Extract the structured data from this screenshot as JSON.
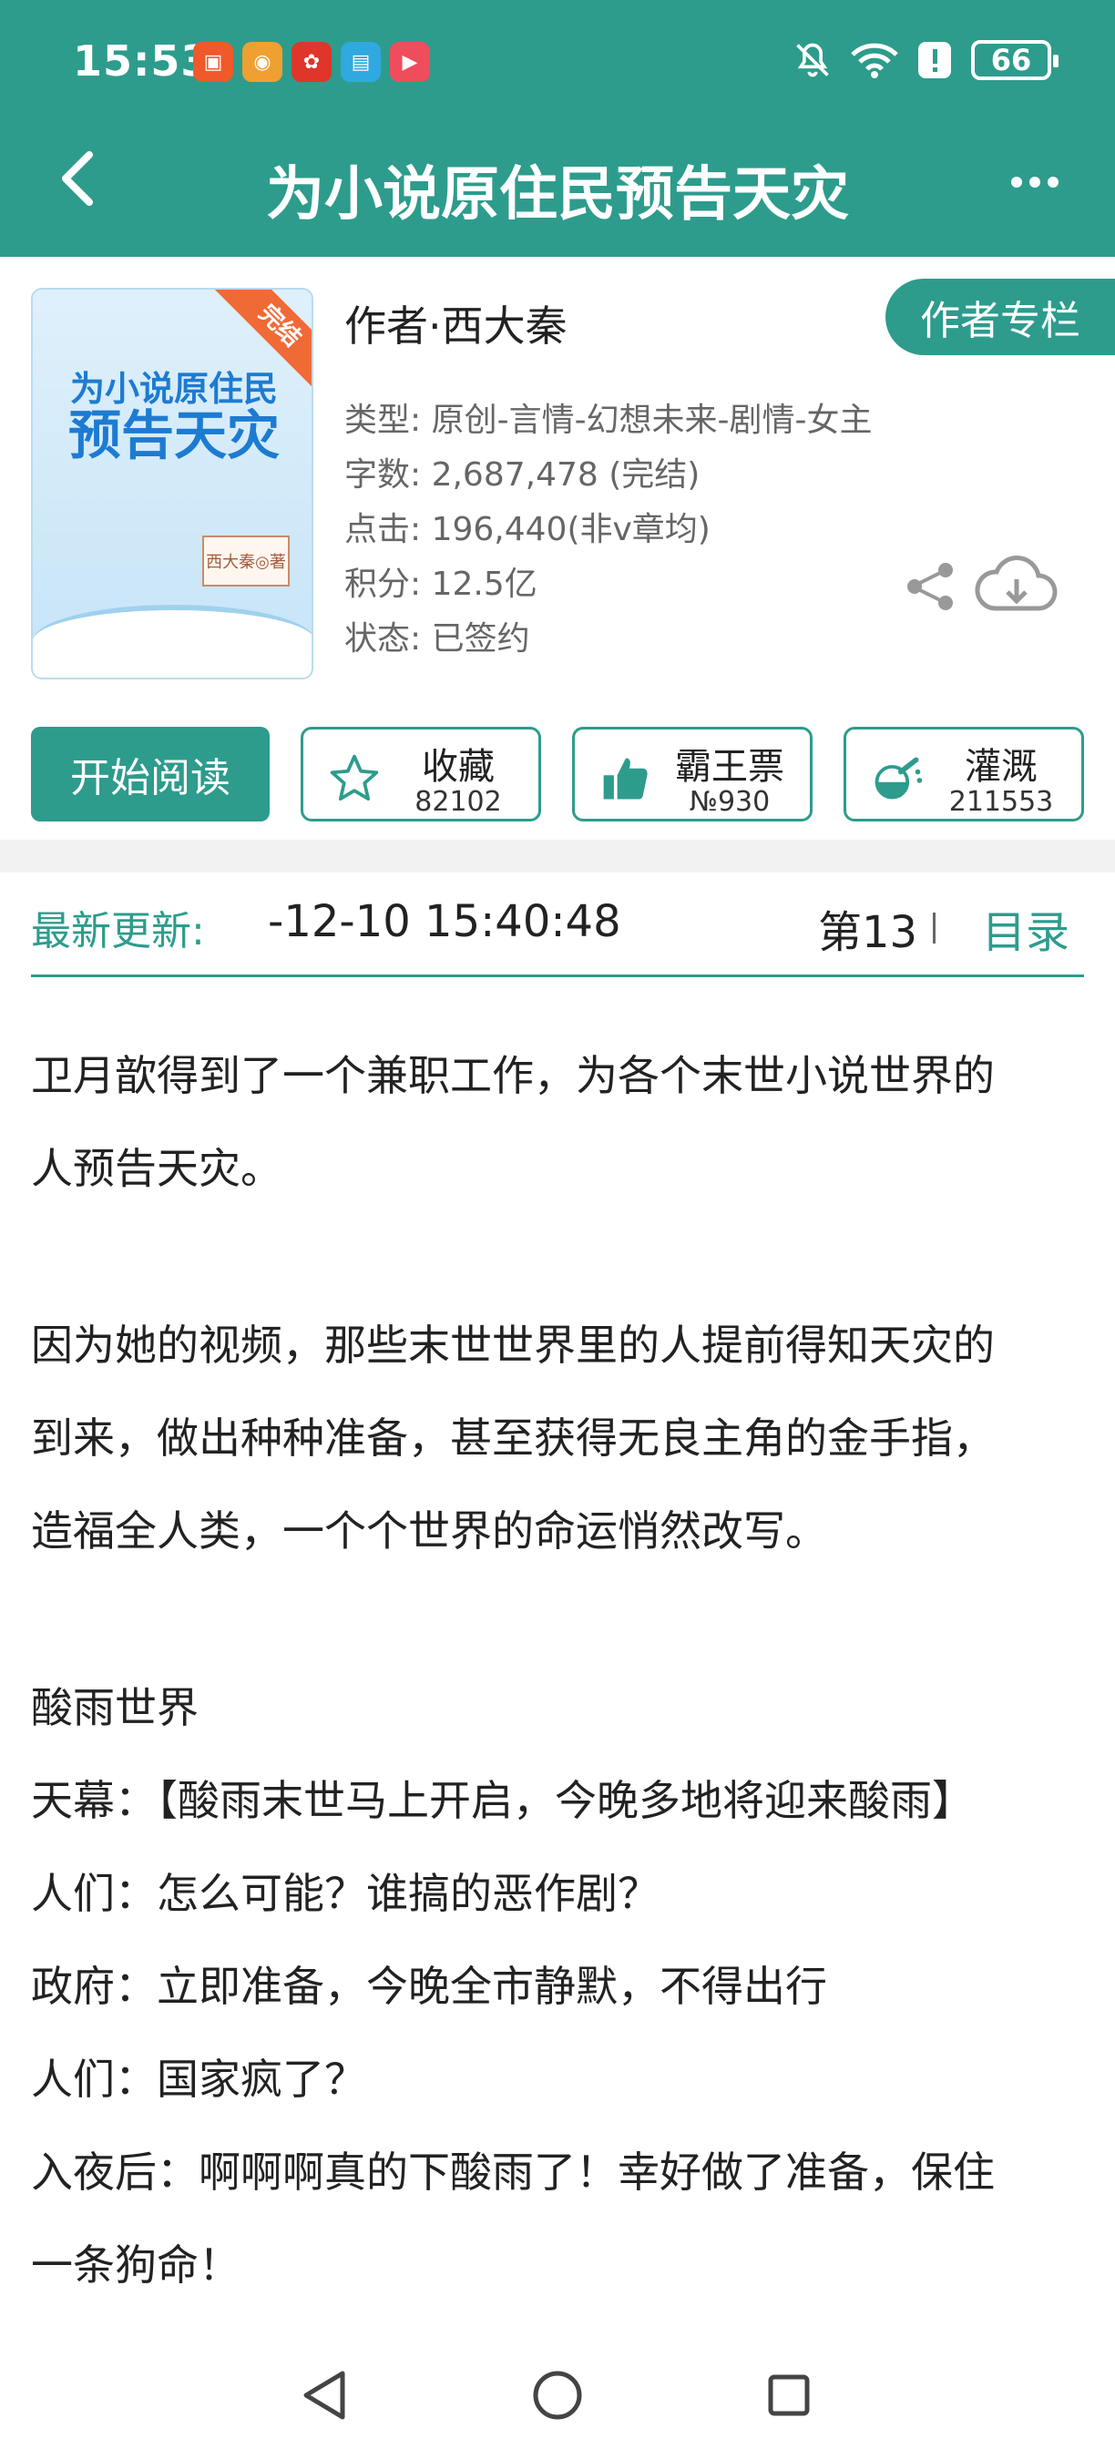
{
  "status_bar": {
    "time": "15:53",
    "battery": "66",
    "app_icons": [
      {
        "name": "app-red-square-icon",
        "color": "#f0592a"
      },
      {
        "name": "weibo-icon",
        "color": "#f0a030"
      },
      {
        "name": "pinduoduo-icon",
        "color": "#e0352b"
      },
      {
        "name": "reader-app-icon",
        "color": "#30a8e0"
      },
      {
        "name": "video-app-icon",
        "color": "#ef4d5c"
      }
    ]
  },
  "header": {
    "title": "为小说原住民预告天灾",
    "back_icon": "chevron-left-icon",
    "more_icon": "more-dots-icon"
  },
  "book": {
    "cover": {
      "ribbon": "完结",
      "title_line1": "为小说原住民",
      "title_line2": "预告天灾",
      "signature": "西大秦◎著"
    },
    "author": "作者·西大秦",
    "author_column_button": "作者专栏",
    "meta": {
      "genre": "类型: 原创-言情-幻想未来-剧情-女主",
      "word_count": "字数: 2,687,478 (完结)",
      "clicks": "点击: 196,440(非v章均)",
      "score": "积分: 12.5亿",
      "status": "状态: 已签约"
    }
  },
  "actions": {
    "read_button": "开始阅读",
    "collect": {
      "label": "收藏",
      "count": "82102"
    },
    "bawang": {
      "label": "霸王票",
      "count": "№930"
    },
    "nutrient": {
      "label": "灌溉",
      "count": "211553"
    }
  },
  "update": {
    "label": "最新更新:",
    "time": "-12-10 15:40:48",
    "chapter": "第13",
    "toc_link": "目录"
  },
  "synopsis": [
    "卫月歆得到了一个兼职工作，为各个末世小说世界的",
    "人预告天灾。",
    "",
    "因为她的视频，那些末世世界里的人提前得知天灾的",
    "到来，做出种种准备，甚至获得无良主角的金手指，",
    "造福全人类，一个个世界的命运悄然改写。",
    "",
    "酸雨世界",
    "天幕：【酸雨末世马上开启，今晚多地将迎来酸雨】",
    "人们：怎么可能？谁搞的恶作剧？",
    "政府：立即准备，今晚全市静默，不得出行",
    "人们：国家疯了？",
    "入夜后：啊啊啊真的下酸雨了！幸好做了准备，保住",
    "一条狗命！"
  ],
  "colors": {
    "accent": "#2d9c8c",
    "text": "#222222",
    "meta": "#666666"
  }
}
